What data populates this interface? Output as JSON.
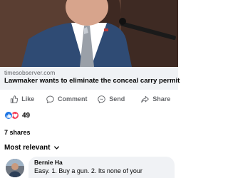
{
  "post": {
    "link": {
      "domain": "timesobserver.com",
      "headline": "Lawmaker wants to eliminate the conceal carry permit"
    }
  },
  "actions": {
    "like": "Like",
    "comment": "Comment",
    "send": "Send",
    "share": "Share"
  },
  "reactions": {
    "count": "49",
    "types": [
      "like",
      "love"
    ]
  },
  "shares": "7 shares",
  "comments": {
    "sort_label": "Most relevant",
    "items": [
      {
        "author": "Bernie Ha",
        "text": "Easy. 1. Buy a gun. 2. Its none of your"
      }
    ]
  },
  "colors": {
    "accent": "#1b74e4",
    "love": "#f33e58",
    "muted_text": "#65676b",
    "link_bg": "#f0f2f5"
  }
}
